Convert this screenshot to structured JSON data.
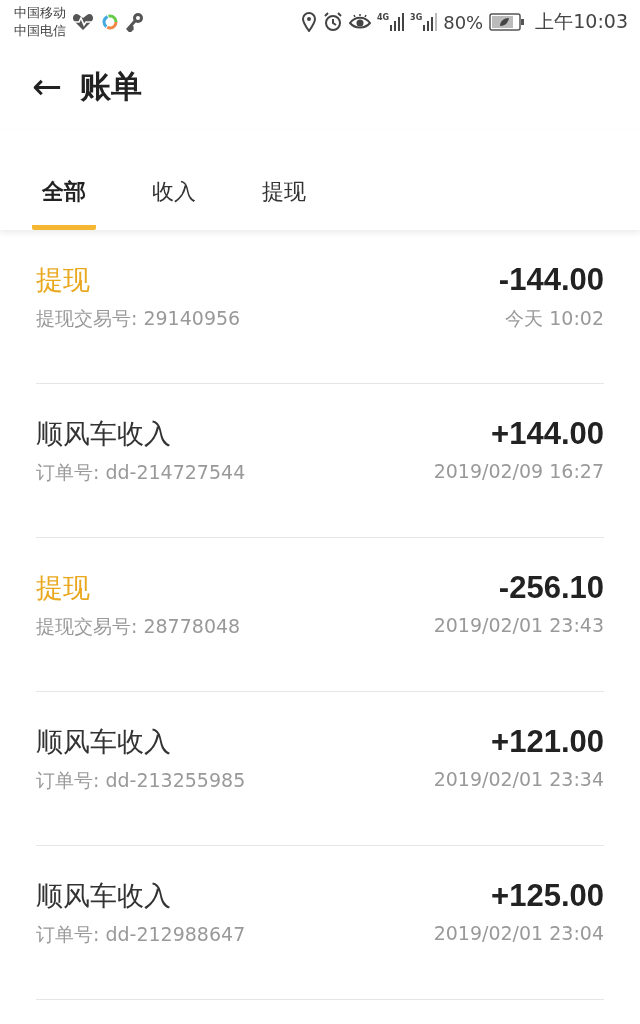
{
  "status_bar": {
    "carriers": [
      "中国移动",
      "中国电信"
    ],
    "network_labels": [
      "4G",
      "3G"
    ],
    "battery": "80%",
    "time": "上午10:03"
  },
  "header": {
    "back_icon": "←",
    "title": "账单"
  },
  "tabs": [
    {
      "label": "全部",
      "selected": true
    },
    {
      "label": "收入",
      "selected": false
    },
    {
      "label": "提现",
      "selected": false
    }
  ],
  "transactions": [
    {
      "kind": "withdraw",
      "title": "提现",
      "reference": "提现交易号: 29140956",
      "amount": "-144.00",
      "time": "今天  10:02"
    },
    {
      "kind": "income",
      "title": "顺风车收入",
      "reference": "订单号: dd-214727544",
      "amount": "+144.00",
      "time": "2019/02/09 16:27"
    },
    {
      "kind": "withdraw",
      "title": "提现",
      "reference": "提现交易号: 28778048",
      "amount": "-256.10",
      "time": "2019/02/01 23:43"
    },
    {
      "kind": "income",
      "title": "顺风车收入",
      "reference": "订单号: dd-213255985",
      "amount": "+121.00",
      "time": "2019/02/01 23:34"
    },
    {
      "kind": "income",
      "title": "顺风车收入",
      "reference": "订单号: dd-212988647",
      "amount": "+125.00",
      "time": "2019/02/01 23:04"
    }
  ]
}
